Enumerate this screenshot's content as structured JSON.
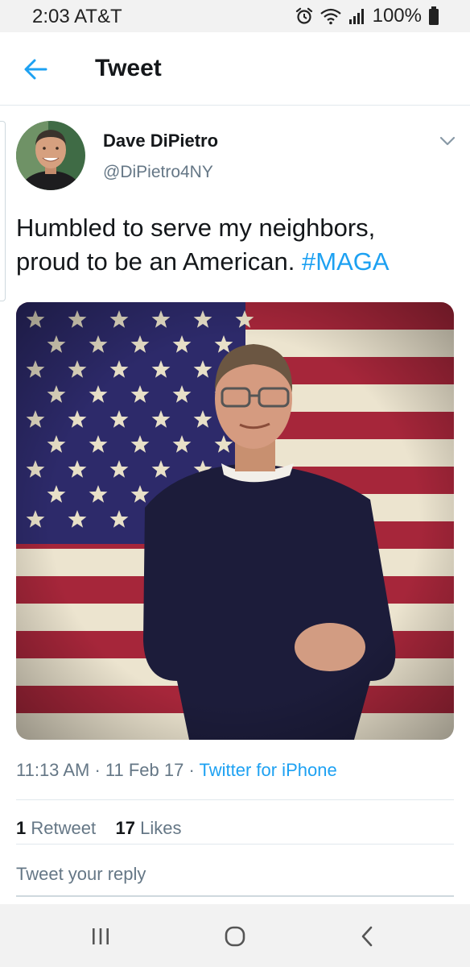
{
  "status_bar": {
    "time": "2:03",
    "carrier": "AT&T",
    "battery": "100%",
    "icons": [
      "alarm-icon",
      "wifi-icon",
      "signal-icon",
      "battery-icon"
    ]
  },
  "header": {
    "title": "Tweet",
    "back_icon": "arrow-left-icon"
  },
  "tweet": {
    "author_name": "Dave DiPietro",
    "author_handle": "@DiPietro4NY",
    "text_line1": "Humbled to serve my neighbors,",
    "text_line2_prefix": "proud to be an American.",
    "hashtag": "#MAGA",
    "time": "11:13 AM",
    "date": "11 Feb 17",
    "source": "Twitter for iPhone",
    "retweets_count": "1",
    "retweets_label": "Retweet",
    "likes_count": "17",
    "likes_label": "Likes"
  },
  "reply": {
    "placeholder": "Tweet your reply"
  },
  "navbar": {
    "icons": [
      "recent-apps-icon",
      "home-icon",
      "back-icon"
    ]
  },
  "colors": {
    "accent": "#1da1f2",
    "secondary_text": "#657786",
    "primary_text": "#14171a"
  }
}
